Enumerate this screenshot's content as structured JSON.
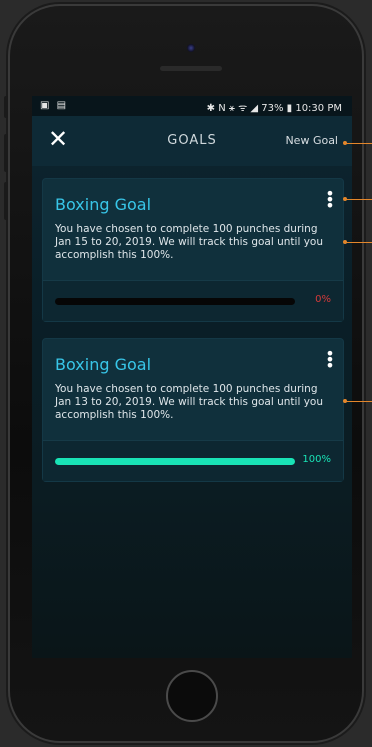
{
  "status": {
    "left_icons": "▣ ▤",
    "right_text": "✱ N ⚹ ᯤ ◢ 73% ▮ 10:30 PM"
  },
  "header": {
    "close_label": "✕",
    "title": "GOALS",
    "new_goal_label": "New Goal"
  },
  "goals": [
    {
      "title": "Boxing Goal",
      "menu_label": "⋮",
      "description": "You have chosen to complete 100 punches during Jan 15 to 20, 2019. We will track this goal until you accomplish this 100%.",
      "progress": 0,
      "progress_label": "0%"
    },
    {
      "title": "Boxing Goal",
      "menu_label": "⋮",
      "description": "You have chosen to complete 100 punches during Jan 13 to 20, 2019. We will track this goal until you accomplish this 100%.",
      "progress": 1,
      "progress_label": "100%"
    }
  ],
  "colors": {
    "accent": "#38c6e8",
    "progress_fill": "#19e3b6",
    "zero_percent": "#d43a3a",
    "annotation": "#e3862b"
  }
}
